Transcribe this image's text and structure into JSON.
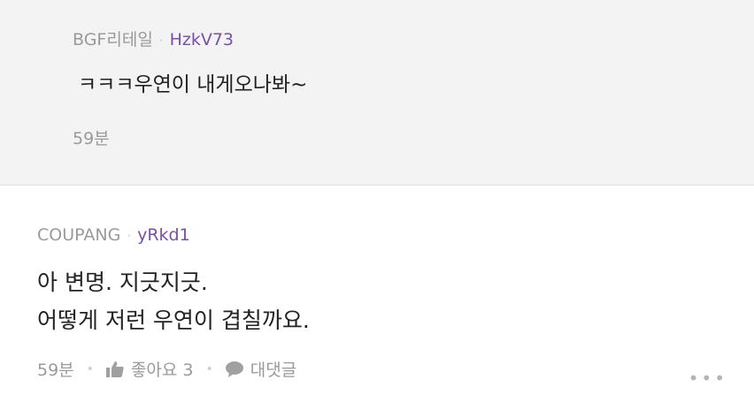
{
  "reply": {
    "source": "BGF리테일",
    "user": "HzkV73",
    "text": "ㅋㅋㅋ우연이 내게오나봐~",
    "time": "59분"
  },
  "comment": {
    "source": "COUPANG",
    "user": "yRkd1",
    "lines": [
      "아 변명.  지긋지긋.",
      "어떻게 저런 우연이 겹칠까요."
    ],
    "time": "59분",
    "like_label": "좋아요 3",
    "reply_label": "대댓글",
    "more_label": "•••"
  },
  "colors": {
    "nick": "#7a4fa6",
    "meta": "#9a9a9a",
    "reply_bg": "#f3f3f3"
  },
  "icons": {
    "like": "thumbs-up-icon",
    "reply": "speech-bubble-icon",
    "more": "more-dots-icon"
  }
}
